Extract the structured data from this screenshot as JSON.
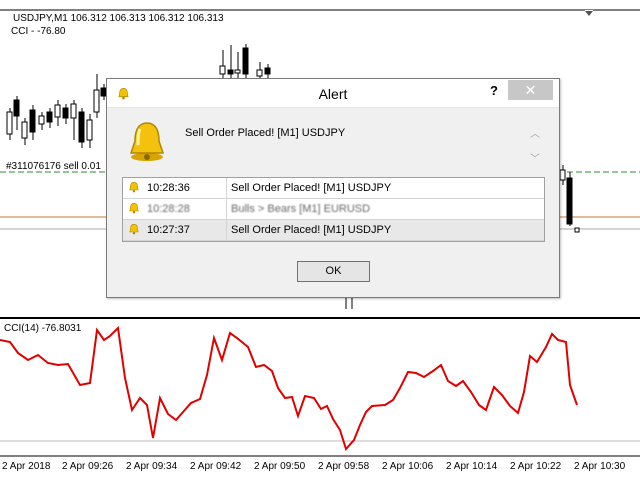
{
  "chart_header": {
    "symbol_info": "USDJPY,M1  106.312 106.313 106.312 106.313",
    "cci_info": "CCI - -76.80",
    "order_label": "#311076176 sell 0.01",
    "triangle_icon": "triangle-down-icon"
  },
  "indicator": {
    "label": "CCI(14) -76.8031"
  },
  "time_axis": [
    "2 Apr 2018",
    "2 Apr 09:26",
    "2 Apr 09:34",
    "2 Apr 09:42",
    "2 Apr 09:50",
    "2 Apr 09:58",
    "2 Apr 10:06",
    "2 Apr 10:14",
    "2 Apr 10:22",
    "2 Apr 10:30"
  ],
  "dialog": {
    "title": "Alert",
    "help": "?",
    "close": "✕",
    "message": "Sell Order Placed!  [M1]  USDJPY",
    "scroll_up": "︿",
    "scroll_down": "﹀",
    "rows": [
      {
        "time": "10:28:36",
        "message": "Sell Order Placed!  [M1]  USDJPY"
      },
      {
        "time": "10:28:28",
        "message": "Bulls > Bears  [M1]  EURUSD"
      },
      {
        "time": "10:27:37",
        "message": "Sell Order Placed!  [M1]  USDJPY"
      }
    ],
    "ok_label": "OK",
    "icons": {
      "title": "bell-icon",
      "main": "bell-icon"
    }
  },
  "chart_data": {
    "type": "line",
    "title": "CCI(14) -76.8031",
    "series": [
      {
        "name": "CCI(14)",
        "color": "#e00000"
      }
    ],
    "colors": {
      "cci": "#e00000",
      "sell_line": "#2e8b2e",
      "price_line": "#c87533",
      "candles": "#000000"
    }
  }
}
